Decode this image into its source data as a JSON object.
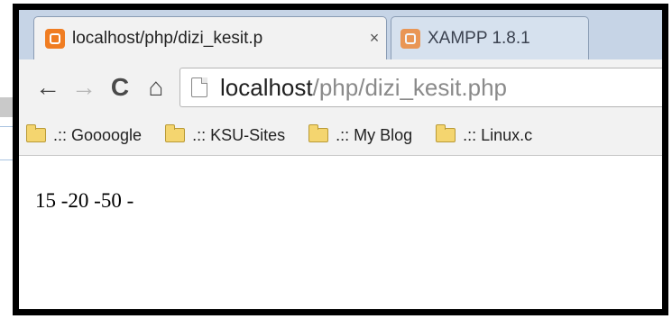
{
  "tabs": [
    {
      "title": "localhost/php/dizi_kesit.p",
      "close": "×",
      "icon": "xampp-favicon",
      "active": true
    },
    {
      "title": "XAMPP 1.8.1",
      "icon": "xampp-favicon",
      "active": false
    }
  ],
  "toolbar": {
    "back": "←",
    "forward": "→",
    "reload": "C",
    "home": "⌂"
  },
  "address": {
    "host": "localhost",
    "path": "/php/dizi_kesit.php"
  },
  "bookmarks": [
    {
      "label": ".:: Goooogle",
      "icon": "folder-icon"
    },
    {
      "label": ".:: KSU-Sites",
      "icon": "folder-icon"
    },
    {
      "label": ".:: My Blog",
      "icon": "folder-icon"
    },
    {
      "label": ".:: Linux.c",
      "icon": "folder-icon"
    }
  ],
  "page": {
    "output": "15 -20 -50 -"
  },
  "colors": {
    "frame": "#000000",
    "tabstrip": "#c6d4e6",
    "xampp_orange": "#f07d22"
  }
}
